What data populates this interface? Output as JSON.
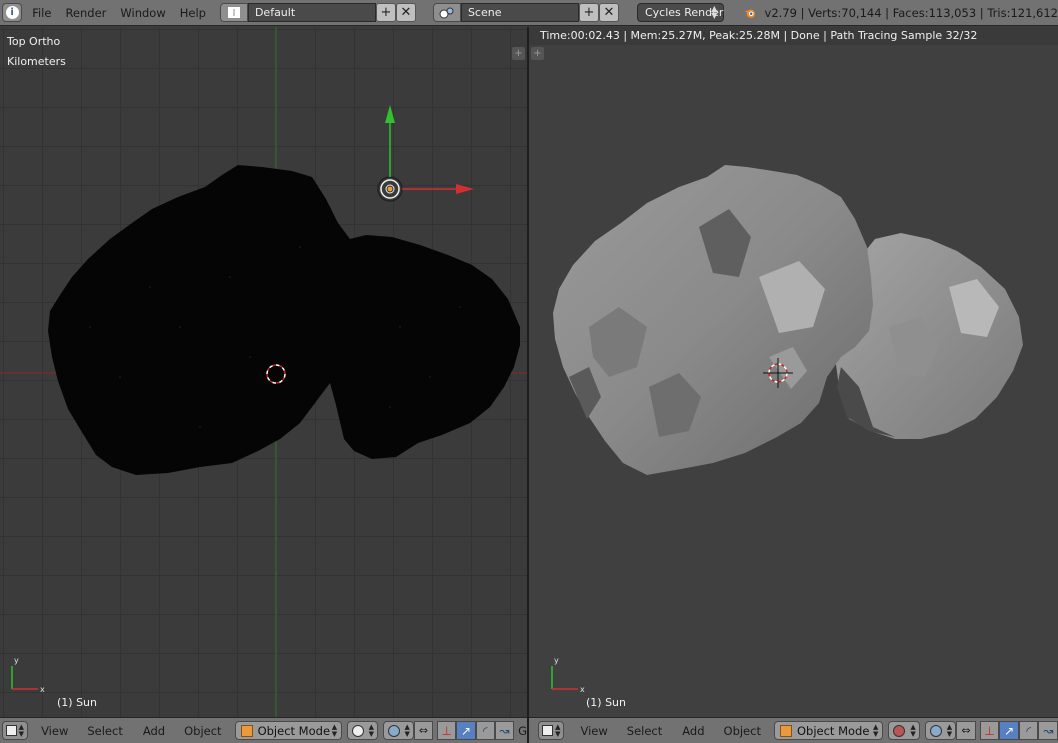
{
  "top_header": {
    "menus": [
      "File",
      "Render",
      "Window",
      "Help"
    ],
    "screen_layout": "Default",
    "scene": "Scene",
    "render_engine": "Cycles Render",
    "stats": "v2.79 | Verts:70,144 | Faces:113,053 | Tris:121,612"
  },
  "left_viewport": {
    "view_name": "Top Ortho",
    "units": "Kilometers",
    "object_label": "(1) Sun"
  },
  "right_viewport": {
    "render_status": "Time:00:02.43 | Mem:25.27M, Peak:25.28M | Done | Path Tracing Sample 32/32",
    "object_label": "(1) Sun"
  },
  "bottom_header": {
    "menus": [
      "View",
      "Select",
      "Add",
      "Object"
    ],
    "mode": "Object Mode",
    "truncated_label": "G"
  },
  "axis": {
    "y": "y",
    "x": "x"
  },
  "colors": {
    "header_bg": "#727272",
    "viewport_bg": "#3b3b3b",
    "axis_red": "#d03030",
    "axis_green": "#30c030",
    "active_tool": "#5680c2"
  }
}
